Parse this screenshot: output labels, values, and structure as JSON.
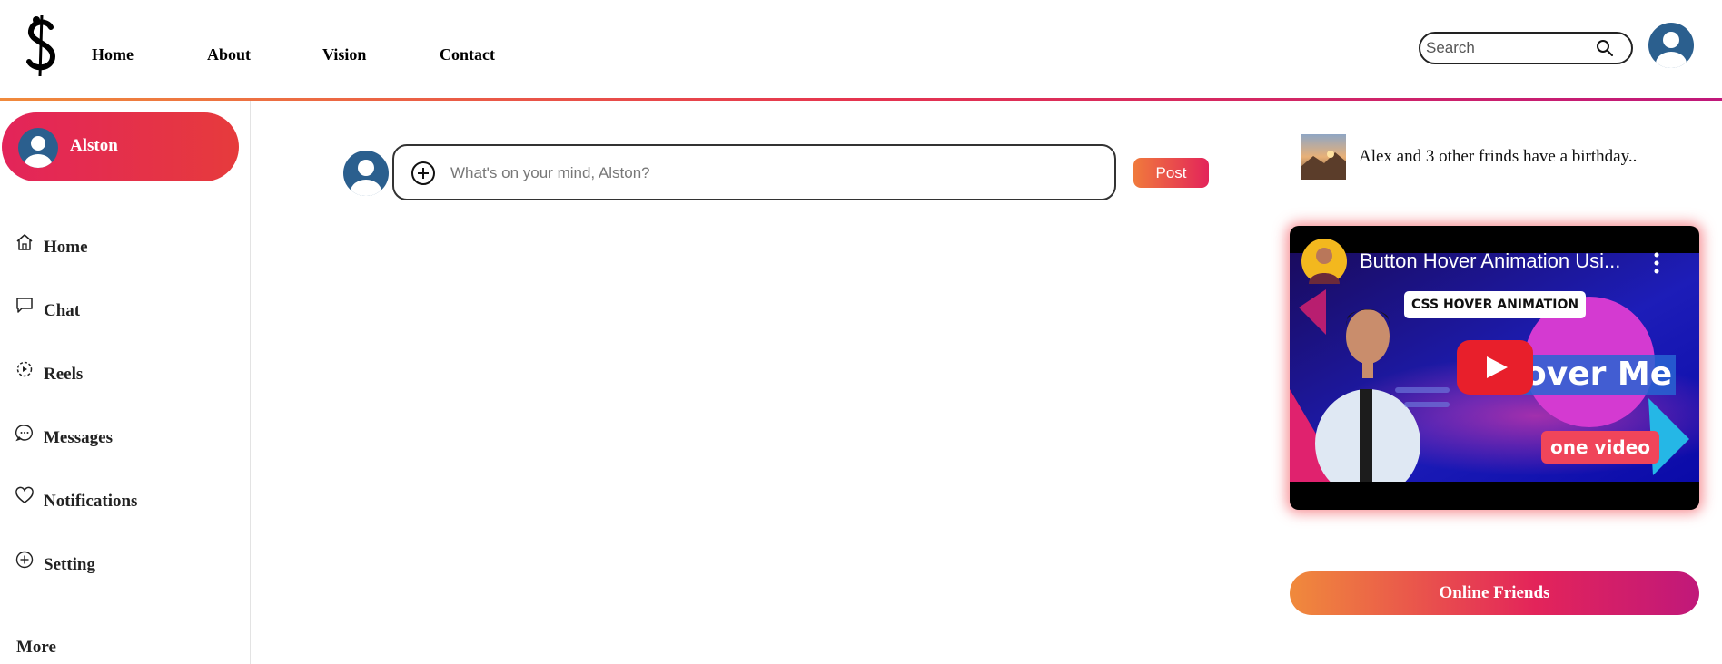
{
  "header": {
    "logo_icon": "dollar-sign-logo-icon",
    "nav": [
      "Home",
      "About",
      "Vision",
      "Contact"
    ],
    "search_placeholder": "Search",
    "search_icon": "search-icon",
    "avatar_icon": "user-avatar-icon"
  },
  "sidebar": {
    "profile_name": "Alston",
    "items": [
      {
        "label": "Home",
        "icon": "home-icon"
      },
      {
        "label": "Chat",
        "icon": "chat-icon"
      },
      {
        "label": "Reels",
        "icon": "reels-icon"
      },
      {
        "label": "Messages",
        "icon": "messages-icon"
      },
      {
        "label": "Notifications",
        "icon": "heart-icon"
      },
      {
        "label": "Setting",
        "icon": "plus-circle-icon"
      }
    ],
    "more_label": "More"
  },
  "composer": {
    "placeholder": "What's on your mind, Alston?",
    "post_label": "Post"
  },
  "right": {
    "birthday_text": "Alex and 3 other frinds have a birthday..",
    "video": {
      "title": "Button Hover Animation Usi...",
      "badge": "CSS HOVER ANIMATION",
      "hover_text": "over Me",
      "one_video": "one video"
    },
    "online_friends_label": "Online Friends"
  },
  "colors": {
    "accent_pink": "#e3245a",
    "accent_orange": "#f08a3c",
    "accent_magenta": "#c0187a",
    "avatar_blue": "#2b5f8e"
  }
}
